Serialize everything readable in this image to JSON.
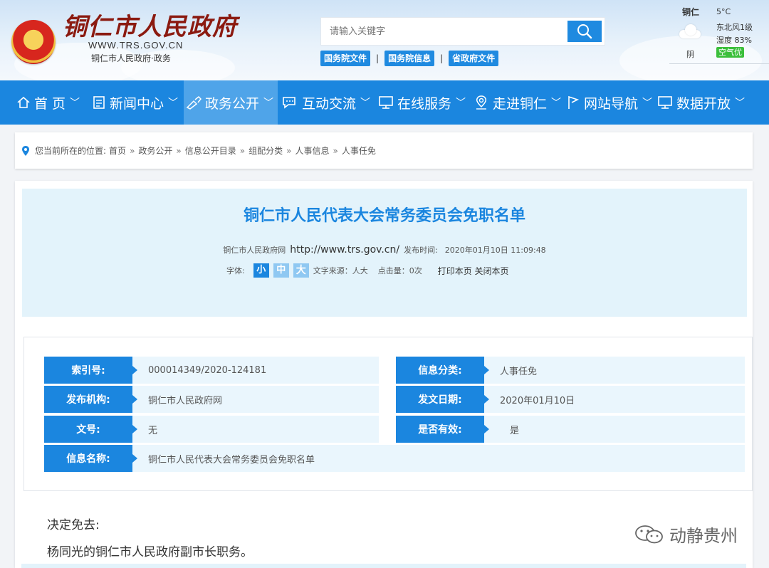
{
  "header": {
    "logo_title": "铜仁市人民政府",
    "logo_url": "WWW.TRS.GOV.CN",
    "logo_subtitle": "铜仁市人民政府·政务",
    "search": {
      "placeholder": "请输入关键字"
    },
    "quick_links": [
      "国务院文件",
      "国务院信息",
      "省政府文件"
    ]
  },
  "weather": {
    "city": "铜仁",
    "temperature": "5°C",
    "wind": "东北风1级",
    "humidity": "湿度 83%",
    "condition": "阴",
    "air_quality": "空气优"
  },
  "nav": {
    "items": [
      {
        "label": "首 页",
        "icon": "home-icon"
      },
      {
        "label": "新闻中心",
        "icon": "news-icon"
      },
      {
        "label": "政务公开",
        "icon": "pen-icon",
        "active": true
      },
      {
        "label": "互动交流",
        "icon": "chat-icon"
      },
      {
        "label": "在线服务",
        "icon": "monitor-icon"
      },
      {
        "label": "走进铜仁",
        "icon": "location-icon"
      },
      {
        "label": "网站导航",
        "icon": "flag-icon"
      },
      {
        "label": "数据开放",
        "icon": "monitor-icon"
      }
    ]
  },
  "breadcrumb": {
    "prefix": "您当前所在的位置:",
    "items": [
      "首页",
      "政务公开",
      "信息公开目录",
      "组配分类",
      "人事信息",
      "人事任免"
    ]
  },
  "article": {
    "title": "铜仁市人民代表大会常务委员会免职名单",
    "source_site": "铜仁市人民政府网",
    "source_url": "http://www.trs.gov.cn/",
    "publish_label": "发布时间:",
    "publish_time": "2020年01月10日 11:09:48",
    "font_label": "字体:",
    "font_sizes": [
      "小",
      "中",
      "大"
    ],
    "text_source": "文字来源：人大",
    "clicks": "点击量：0次",
    "print_close": "打印本页 关闭本页"
  },
  "info": {
    "index_label": "索引号:",
    "index_value": "000014349/2020-124181",
    "category_label": "信息分类:",
    "category_value": "人事任免",
    "publisher_label": "发布机构:",
    "publisher_value": "铜仁市人民政府网",
    "date_label": "发文日期:",
    "date_value": "2020年01月10日",
    "docno_label": "文号:",
    "docno_value": "无",
    "valid_label": "是否有效:",
    "valid_value": "是",
    "name_label": "信息名称:",
    "name_value": "铜仁市人民代表大会常务委员会免职名单"
  },
  "body": {
    "line1": "决定免去:",
    "line2": "杨同光的铜仁市人民政府副市长职务。"
  },
  "watermark": {
    "text": "动静贵州"
  },
  "colors": {
    "primary": "#1b86df",
    "nav_active": "#4fa4e9",
    "title_panel": "#e3f3fb",
    "air_quality": "#3bbf3b"
  }
}
